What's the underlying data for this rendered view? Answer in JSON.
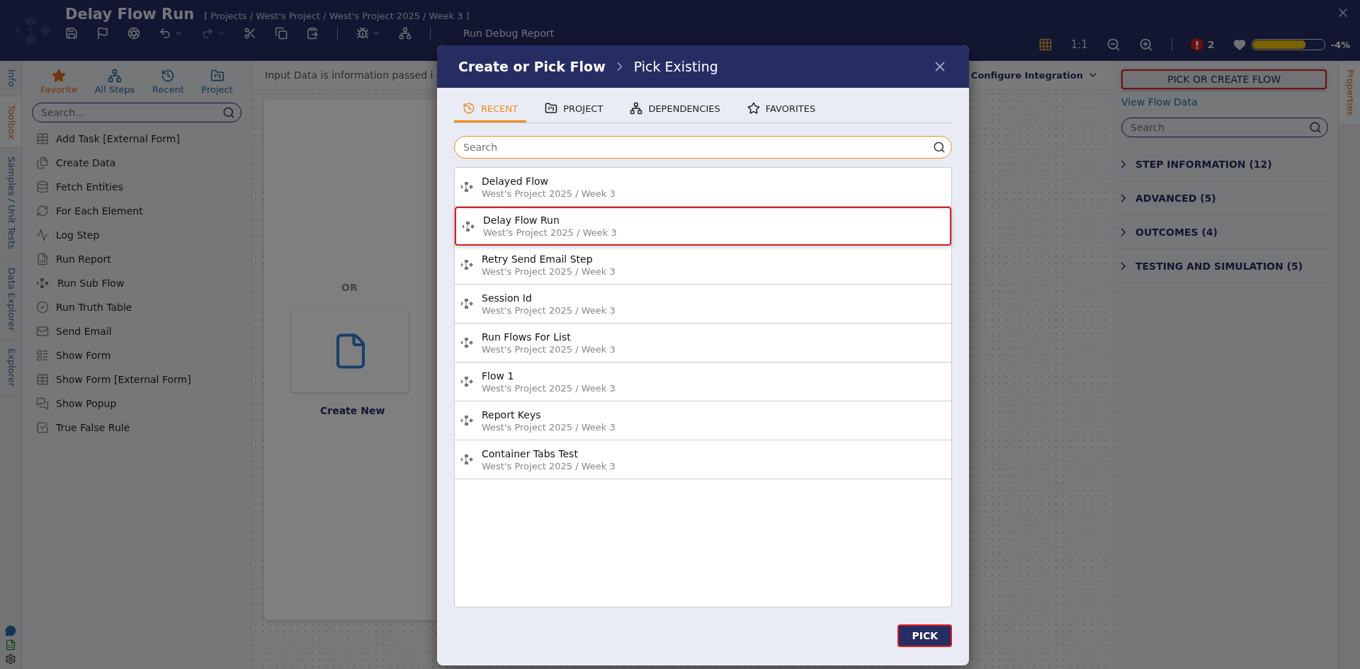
{
  "header": {
    "title": "Delay Flow Run",
    "breadcrumb": "[ Projects / West's Project / West's Project 2025 / Week 3 ]",
    "toolbar_label": "Run Debug Report",
    "zoom_reset": "1:1",
    "error_count": "2",
    "health": {
      "level": 0.74,
      "reading": "-4%"
    }
  },
  "left_tabs": [
    {
      "label": "Info",
      "selected": false
    },
    {
      "label": "Toolbox",
      "selected": true
    },
    {
      "label": "Samples / Unit Tests",
      "selected": false
    },
    {
      "label": "Data Explorer",
      "selected": false
    },
    {
      "label": "Explorer",
      "selected": false
    }
  ],
  "toolbox": {
    "filters": [
      {
        "label": "Favorite",
        "selected": true
      },
      {
        "label": "All Steps",
        "selected": false
      },
      {
        "label": "Recent",
        "selected": false
      },
      {
        "label": "Project",
        "selected": false
      }
    ],
    "search": {
      "placeholder": "Search..."
    },
    "items": [
      "Add Task [External Form]",
      "Create Data",
      "Fetch Entities",
      "For Each Element",
      "Log Step",
      "Run Report",
      "Run Sub Flow",
      "Run Truth Table",
      "Send Email",
      "Show Form",
      "Show Form [External Form]",
      "Show Popup",
      "True False Rule"
    ]
  },
  "canvas": {
    "info": "Input Data is information passed i",
    "configure": "Configure Integration",
    "or": "OR",
    "create_new": "Create New"
  },
  "properties": {
    "pick_button": "PICK OR CREATE FLOW",
    "view_link": "View Flow Data",
    "search": {
      "placeholder": "Search"
    },
    "sections": [
      {
        "label": "STEP INFORMATION (12)",
        "expanded": false
      },
      {
        "label": "ADVANCED (5)",
        "expanded": false
      },
      {
        "label": "OUTCOMES (4)",
        "expanded": false
      },
      {
        "label": "TESTING AND SIMULATION (5)",
        "expanded": false
      }
    ]
  },
  "right_tabs": [
    {
      "label": "Properties",
      "selected": true
    }
  ],
  "dialog": {
    "title": "Create or Pick Flow",
    "subtitle": "Pick Existing",
    "tabs": [
      {
        "label": "RECENT",
        "selected": true
      },
      {
        "label": "PROJECT",
        "selected": false
      },
      {
        "label": "DEPENDENCIES",
        "selected": false
      },
      {
        "label": "FAVORITES",
        "selected": false
      }
    ],
    "search": {
      "placeholder": "Search"
    },
    "flows": [
      {
        "name": "Delayed Flow",
        "path": "West's Project 2025 / Week 3",
        "selected": false
      },
      {
        "name": "Delay Flow Run",
        "path": "West's Project 2025 / Week 3",
        "selected": true
      },
      {
        "name": "Retry Send Email Step",
        "path": "West's Project 2025 / Week 3",
        "selected": false
      },
      {
        "name": "Session Id",
        "path": "West's Project 2025 / Week 3",
        "selected": false
      },
      {
        "name": "Run Flows For List",
        "path": "West's Project 2025 / Week 3",
        "selected": false
      },
      {
        "name": "Flow 1",
        "path": "West's Project 2025 / Week 3",
        "selected": false
      },
      {
        "name": "Report Keys",
        "path": "West's Project 2025 / Week 3",
        "selected": false
      },
      {
        "name": "Container Tabs Test",
        "path": "West's Project 2025 / Week 3",
        "selected": false
      }
    ],
    "pick_button": "PICK"
  }
}
